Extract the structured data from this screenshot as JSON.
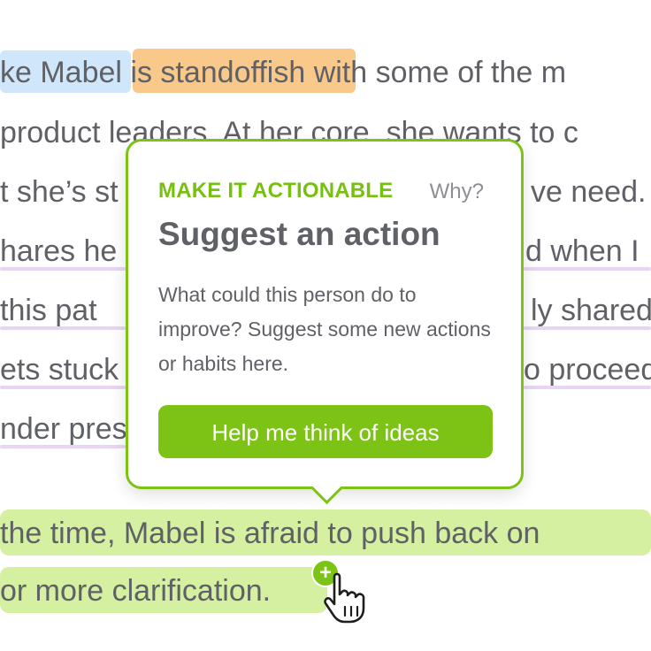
{
  "document": {
    "lines": [
      {
        "segments": [
          {
            "text": "ke Mabel",
            "style": "blue"
          },
          {
            "text": " ",
            "style": "none"
          },
          {
            "text": "is standoffish",
            "style": "orange"
          },
          {
            "text": " with some of the m",
            "style": "none"
          }
        ]
      },
      {
        "text": "product leaders. At her core, she wants to c"
      },
      {
        "text": "t she’s st",
        "right": "ve need."
      },
      {
        "text": "hares he",
        "right": "d when I"
      },
      {
        "text": " this pat",
        "right": "ly shared"
      },
      {
        "text": "ets stuck",
        "right": "o proceed"
      },
      {
        "text": "nder pres"
      },
      {
        "text": " the time, Mabel is afraid to push back on"
      },
      {
        "text": "or more clarification."
      }
    ]
  },
  "popover": {
    "kicker": "MAKE IT ACTIONABLE",
    "why_link": "Why?",
    "title": "Suggest an action",
    "body": "What could this person do to improve? Suggest some new actions or habits here.",
    "cta_label": "Help me think of ideas"
  },
  "icons": {
    "add": "plus-circle-icon",
    "cursor": "hand-pointer-icon"
  },
  "colors": {
    "accent": "#7cc316",
    "highlight_blue": "#cfe6fb",
    "highlight_orange": "#f8c98b",
    "highlight_green": "#d5f0a0",
    "underline_purple": "#e7d5f4"
  }
}
